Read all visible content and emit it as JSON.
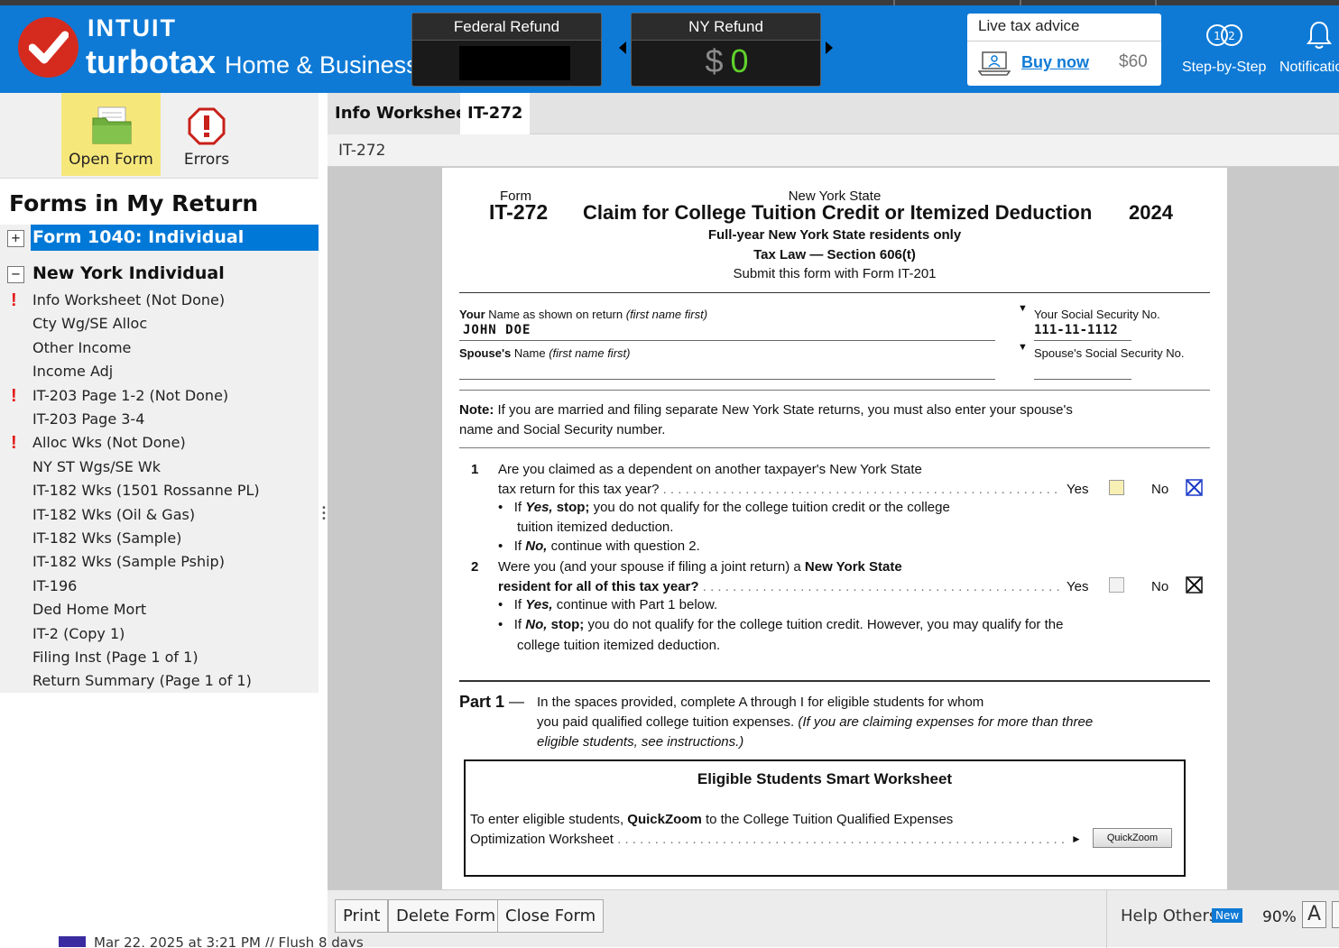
{
  "header": {
    "brand_top": "INTUIT",
    "brand_product": "turbotax",
    "brand_edition": "Home & Business",
    "federal_refund_label": "Federal Refund",
    "ny_refund_label": "NY Refund",
    "ny_refund_dollar": "$",
    "ny_refund_value": "0",
    "live_advice_title": "Live tax advice",
    "buy_now": "Buy now",
    "price": "$60",
    "step_by_step": "Step-by-Step",
    "notifications": "Notifications",
    "colors": {
      "header_bg": "#0e7ad6",
      "refund_green": "#5fd12b",
      "logo_red": "#d52b1e"
    }
  },
  "toolbar": {
    "open_form": "Open Form",
    "errors": "Errors"
  },
  "forms_panel": {
    "title": "Forms in My Return",
    "federal_toggle": "+",
    "federal_group": "Form 1040:  Individual",
    "ny_toggle": "−",
    "ny_group": "New York Individual",
    "alert_symbol": "!",
    "items": [
      {
        "label": "Info Worksheet (Not Done)",
        "alert": true
      },
      {
        "label": "Cty Wg/SE Alloc",
        "alert": false
      },
      {
        "label": "Other Income",
        "alert": false
      },
      {
        "label": "Income Adj",
        "alert": false
      },
      {
        "label": "IT-203 Page 1-2 (Not Done)",
        "alert": true
      },
      {
        "label": "IT-203 Page 3-4",
        "alert": false
      },
      {
        "label": "Alloc Wks (Not Done)",
        "alert": true
      },
      {
        "label": "NY ST Wgs/SE Wk",
        "alert": false
      },
      {
        "label": "IT-182 Wks (1501 Rossanne PL)",
        "alert": false
      },
      {
        "label": "IT-182 Wks (Oil & Gas)",
        "alert": false
      },
      {
        "label": "IT-182 Wks (Sample)",
        "alert": false
      },
      {
        "label": "IT-182 Wks (Sample Pship)",
        "alert": false
      },
      {
        "label": "IT-196",
        "alert": false
      },
      {
        "label": "Ded Home Mort",
        "alert": false
      },
      {
        "label": "IT-2 (Copy 1)",
        "alert": false
      },
      {
        "label": "Filing Inst (Page 1 of 1)",
        "alert": false
      },
      {
        "label": "Return Summary (Page 1 of 1)",
        "alert": false
      }
    ]
  },
  "tabs": [
    {
      "label": "Info Worksheet",
      "active": false
    },
    {
      "label": "IT-272",
      "active": true
    }
  ],
  "form_name": "IT-272",
  "form": {
    "form_word": "Form",
    "form_number": "IT-272",
    "state": "New York State",
    "title": "Claim for College Tuition Credit or Itemized Deduction",
    "year": "2024",
    "subtitle1": "Full-year New York State residents only",
    "subtitle2": "Tax Law — Section 606(t)",
    "subtitle3": "Submit this form with Form IT-201",
    "your_name_bold": "Your",
    "your_name_label": " Name as shown on return ",
    "your_name_hint": "(first name first)",
    "your_name_value": "JOHN DOE",
    "ssn_label": "Your Social Security No.",
    "ssn_value": "111-11-1112",
    "spouse_name_bold": "Spouse's",
    "spouse_name_label": " Name ",
    "spouse_name_hint": "(first name first)",
    "spouse_ssn_label": "Spouse's Social Security No.",
    "note_bold": "Note:",
    "note_line1": " If you are married and filing separate New York State returns, you must also enter your spouse's",
    "note_line2": "name and Social Security number.",
    "q1_num": "1",
    "q1_line1": "Are you claimed as a dependent on another taxpayer's New York State",
    "q1_line2": "tax return for this tax year?",
    "q1_b1_pre": "If ",
    "q1_b1_em": "Yes, ",
    "q1_b1_bold": "stop;",
    "q1_b1_rest": " you do not qualify for the college tuition credit or the college",
    "q1_b1_line2": "tuition itemized deduction.",
    "q1_b2_pre": "If ",
    "q1_b2_em": "No,",
    "q1_b2_rest": " continue with question 2.",
    "q2_num": "2",
    "q2_line1_pre": "Were you (and your spouse if filing a joint return) a ",
    "q2_line1_bold": "New York State",
    "q2_line2": "resident for all of this tax year?",
    "q2_b1_pre": "If ",
    "q2_b1_em": "Yes,",
    "q2_b1_rest": " continue with Part 1 below.",
    "q2_b2_pre": "If ",
    "q2_b2_em": "No, ",
    "q2_b2_bold": "stop;",
    "q2_b2_rest": " you do not qualify for the college tuition credit. However, you may qualify for the",
    "q2_b2_line2": "college tuition itemized deduction.",
    "yes_label": "Yes",
    "no_label": "No",
    "q1_answer": "No",
    "q2_answer": "No",
    "part1_label": "Part 1",
    "part1_dash": "—",
    "part1_line1": "In the spaces provided, complete A through I for eligible students for whom",
    "part1_line2_pre": "you paid qualified college tuition expenses. ",
    "part1_line2_em": "(If you are claiming expenses for more than three",
    "part1_line3_em": "eligible students, see instructions.)",
    "ws_title": "Eligible Students Smart Worksheet",
    "ws_line1_pre": "To enter eligible students, ",
    "ws_line1_bold": "QuickZoom",
    "ws_line1_rest": " to the College Tuition Qualified Expenses",
    "ws_line2": "Optimization Worksheet",
    "quickzoom_button": "QuickZoom"
  },
  "bottom_bar": {
    "print": "Print",
    "delete": "Delete Form",
    "close": "Close Form",
    "help_others": "Help Others",
    "new_badge": "New",
    "zoom": "90%",
    "font_button": "A"
  },
  "taskbar_peek": "Mar 22, 2025 at 3:21 PM // Flush 8 days"
}
